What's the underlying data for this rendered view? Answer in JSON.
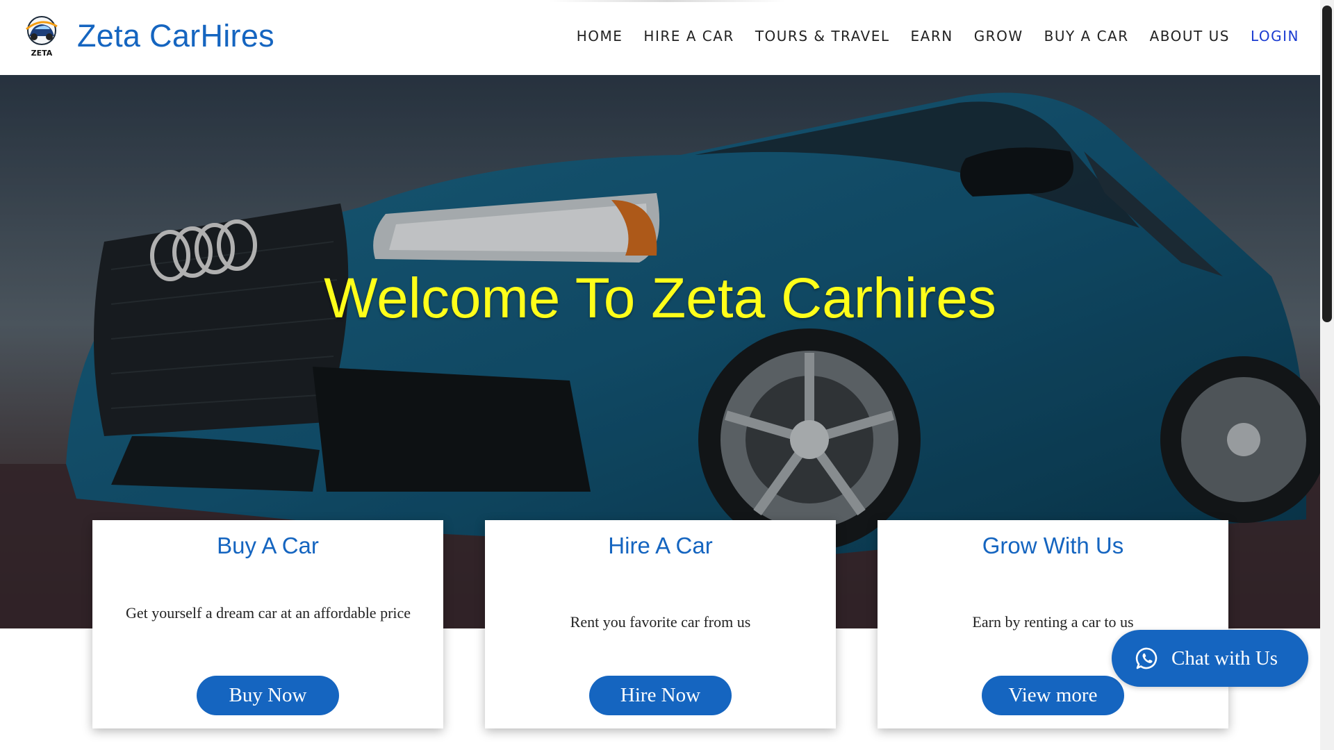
{
  "header": {
    "brand": "Zeta CarHires",
    "logo_text": "ZETA",
    "nav": [
      {
        "label": "HOME"
      },
      {
        "label": "HIRE A CAR"
      },
      {
        "label": "TOURS & TRAVEL"
      },
      {
        "label": "EARN"
      },
      {
        "label": "GROW"
      },
      {
        "label": "BUY A CAR"
      },
      {
        "label": "ABOUT US"
      },
      {
        "label": "LOGIN"
      }
    ]
  },
  "hero": {
    "title": "Welcome To Zeta Carhires",
    "image": "blue-sports-sedan-photo"
  },
  "cards": [
    {
      "title": "Buy A Car",
      "description": "Get yourself a dream car at an affordable price",
      "button": "Buy Now"
    },
    {
      "title": "Hire A Car",
      "description": "Rent you favorite car from us",
      "button": "Hire Now"
    },
    {
      "title": "Grow With Us",
      "description": "Earn by renting a car to us",
      "button": "View more"
    }
  ],
  "chat": {
    "label": "Chat with Us",
    "icon": "whatsapp-icon"
  },
  "colors": {
    "brand": "#1565c0",
    "hero_title": "#ffff1a",
    "login": "#1a3bd1"
  }
}
